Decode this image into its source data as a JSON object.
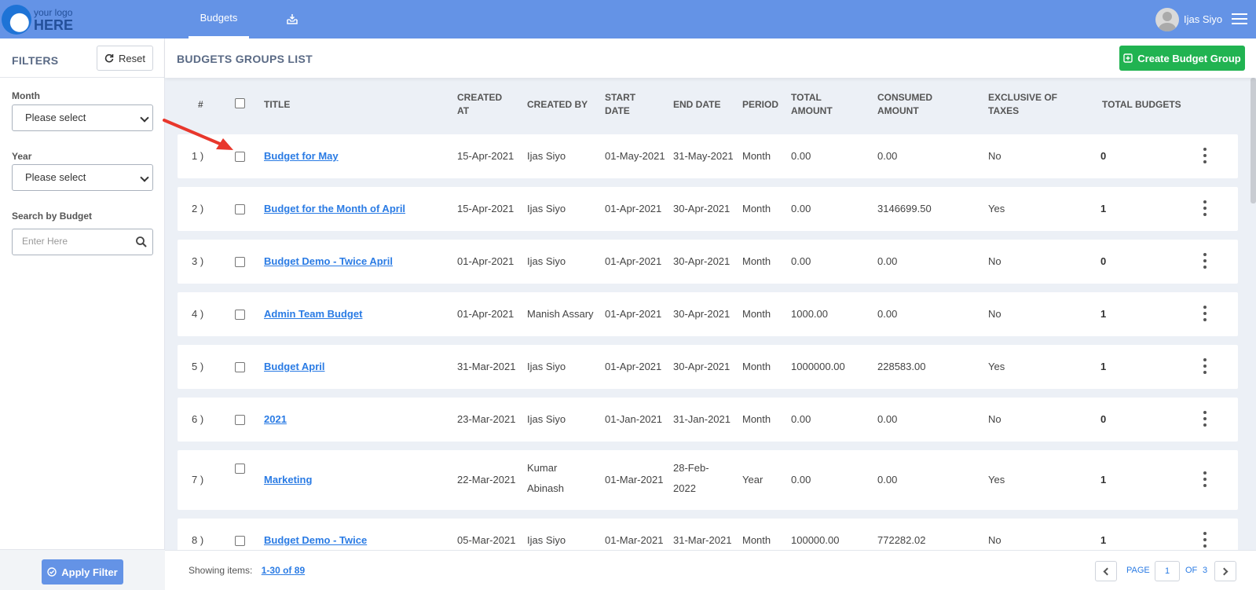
{
  "logo": {
    "line1": "your logo",
    "line2": "HERE"
  },
  "nav": {
    "active_tab": "Budgets",
    "tab_icon": "inbox-download-icon"
  },
  "user": {
    "name": "Ijas Siyo"
  },
  "sidebar": {
    "title": "FILTERS",
    "reset_label": "Reset",
    "month": {
      "label": "Month",
      "value": "Please select"
    },
    "year": {
      "label": "Year",
      "value": "Please select"
    },
    "search": {
      "label": "Search by Budget",
      "placeholder": "Enter Here"
    },
    "apply_label": "Apply Filter"
  },
  "header": {
    "title": "BUDGETS GROUPS LIST",
    "create_label": "Create Budget Group"
  },
  "table": {
    "columns": {
      "num": "#",
      "title": "TITLE",
      "created_at_1": "CREATED",
      "created_at_2": "AT",
      "created_by": "CREATED BY",
      "start_date_1": "START",
      "start_date_2": "DATE",
      "end_date": "END DATE",
      "period": "PERIOD",
      "total_amount_1": "TOTAL",
      "total_amount_2": "AMOUNT",
      "consumed_amount_1": "CONSUMED",
      "consumed_amount_2": "AMOUNT",
      "exclusive_taxes_1": "EXCLUSIVE OF",
      "exclusive_taxes_2": "TAXES",
      "total_budgets": "TOTAL BUDGETS"
    },
    "rows": [
      {
        "num": "1 )",
        "title": "Budget for May",
        "created_at": "15-Apr-2021",
        "created_by": "Ijas Siyo",
        "created_by_2": "",
        "start": "01-May-2021",
        "end": "31-May-2021",
        "end_2": "",
        "period": "Month",
        "total": "0.00",
        "consumed": "0.00",
        "exclusive": "No",
        "budgets": "0"
      },
      {
        "num": "2 )",
        "title": "Budget for the Month of April",
        "created_at": "15-Apr-2021",
        "created_by": "Ijas Siyo",
        "created_by_2": "",
        "start": "01-Apr-2021",
        "end": "30-Apr-2021",
        "end_2": "",
        "period": "Month",
        "total": "0.00",
        "consumed": "3146699.50",
        "exclusive": "Yes",
        "budgets": "1"
      },
      {
        "num": "3 )",
        "title": "Budget Demo - Twice April",
        "created_at": "01-Apr-2021",
        "created_by": "Ijas Siyo",
        "created_by_2": "",
        "start": "01-Apr-2021",
        "end": "30-Apr-2021",
        "end_2": "",
        "period": "Month",
        "total": "0.00",
        "consumed": "0.00",
        "exclusive": "No",
        "budgets": "0"
      },
      {
        "num": "4 )",
        "title": "Admin Team Budget",
        "created_at": "01-Apr-2021",
        "created_by": "Manish Assary",
        "created_by_2": "",
        "start": "01-Apr-2021",
        "end": "30-Apr-2021",
        "end_2": "",
        "period": "Month",
        "total": "1000.00",
        "consumed": "0.00",
        "exclusive": "No",
        "budgets": "1"
      },
      {
        "num": "5 )",
        "title": "Budget April",
        "created_at": "31-Mar-2021",
        "created_by": "Ijas Siyo",
        "created_by_2": "",
        "start": "01-Apr-2021",
        "end": "30-Apr-2021",
        "end_2": "",
        "period": "Month",
        "total": "1000000.00",
        "consumed": "228583.00",
        "exclusive": "Yes",
        "budgets": "1"
      },
      {
        "num": "6 )",
        "title": "2021",
        "created_at": "23-Mar-2021",
        "created_by": "Ijas Siyo",
        "created_by_2": "",
        "start": "01-Jan-2021",
        "end": "31-Jan-2021",
        "end_2": "",
        "period": "Month",
        "total": "0.00",
        "consumed": "0.00",
        "exclusive": "No",
        "budgets": "0"
      },
      {
        "num": "7 )",
        "title": "Marketing",
        "created_at": "22-Mar-2021",
        "created_by": "Kumar",
        "created_by_2": "Abinash",
        "start": "01-Mar-2021",
        "end": "28-Feb-",
        "end_2": "2022",
        "period": "Year",
        "total": "0.00",
        "consumed": "0.00",
        "exclusive": "Yes",
        "budgets": "1"
      },
      {
        "num": "8 )",
        "title": "Budget Demo - Twice",
        "created_at": "05-Mar-2021",
        "created_by": "Ijas Siyo",
        "created_by_2": "",
        "start": "01-Mar-2021",
        "end": "31-Mar-2021",
        "end_2": "",
        "period": "Month",
        "total": "100000.00",
        "consumed": "772282.02",
        "exclusive": "No",
        "budgets": "1"
      }
    ]
  },
  "footer": {
    "showing_label": "Showing items:",
    "range": "1-30",
    "of_word": "of",
    "total": "89",
    "page_label": "PAGE",
    "page_value": "1",
    "of_label": "OF",
    "page_count": "3"
  },
  "colors": {
    "primary": "#6493e6",
    "success": "#21b351",
    "link": "#2a7be4",
    "annotation": "#e8372c"
  }
}
